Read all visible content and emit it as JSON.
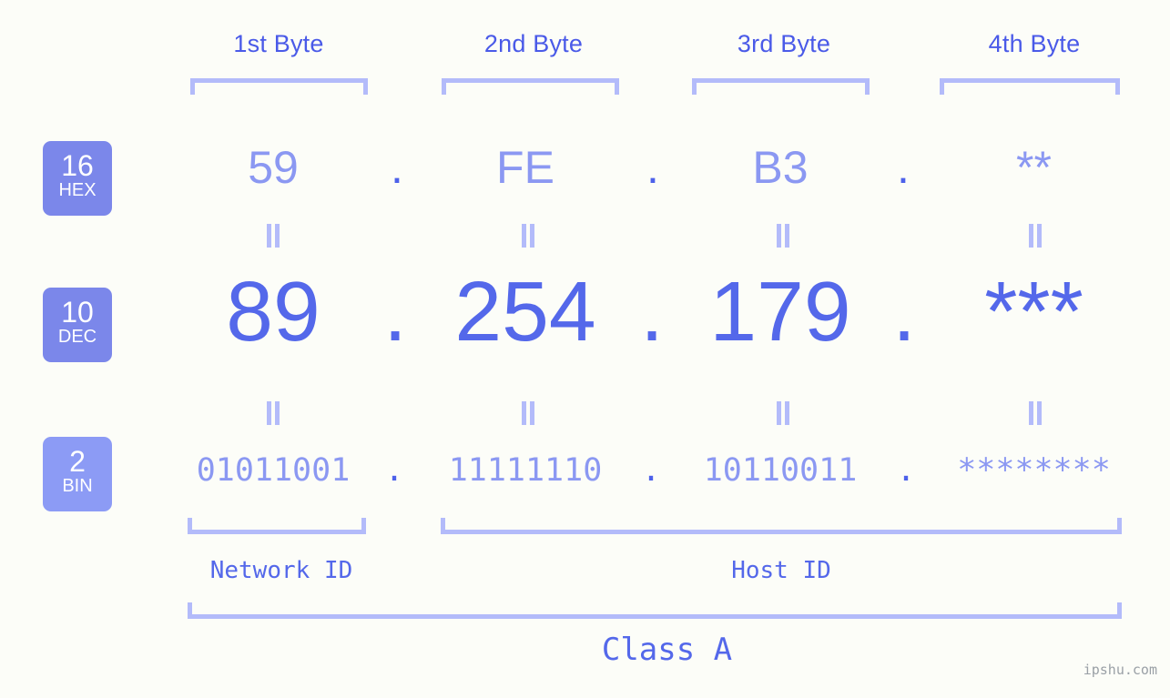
{
  "meta": {
    "background_color": "#fcfdf8",
    "accent_color": "#5468ea",
    "accent_light_color": "#8b98f2",
    "bracket_color": "#b3bbfa",
    "badge_color": "#7b87ea",
    "badge_color_light": "#8c9bf5",
    "watermark": "ipshu.com"
  },
  "byte_headers": [
    {
      "label": "1st Byte"
    },
    {
      "label": "2nd Byte"
    },
    {
      "label": "3rd Byte"
    },
    {
      "label": "4th Byte"
    }
  ],
  "bases": [
    {
      "number": "16",
      "name": "HEX"
    },
    {
      "number": "10",
      "name": "DEC"
    },
    {
      "number": "2",
      "name": "BIN"
    }
  ],
  "rows": {
    "hex": {
      "base_number": "16",
      "base_name": "HEX",
      "values": [
        "59",
        "FE",
        "B3",
        "**"
      ],
      "separator": "."
    },
    "dec": {
      "base_number": "10",
      "base_name": "DEC",
      "values": [
        "89",
        "254",
        "179",
        "***"
      ],
      "separator": "."
    },
    "bin": {
      "base_number": "2",
      "base_name": "BIN",
      "values": [
        "01011001",
        "11111110",
        "10110011",
        "********"
      ],
      "separator": "."
    }
  },
  "segments": {
    "network_id": "Network ID",
    "host_id": "Host ID",
    "class": "Class A"
  }
}
